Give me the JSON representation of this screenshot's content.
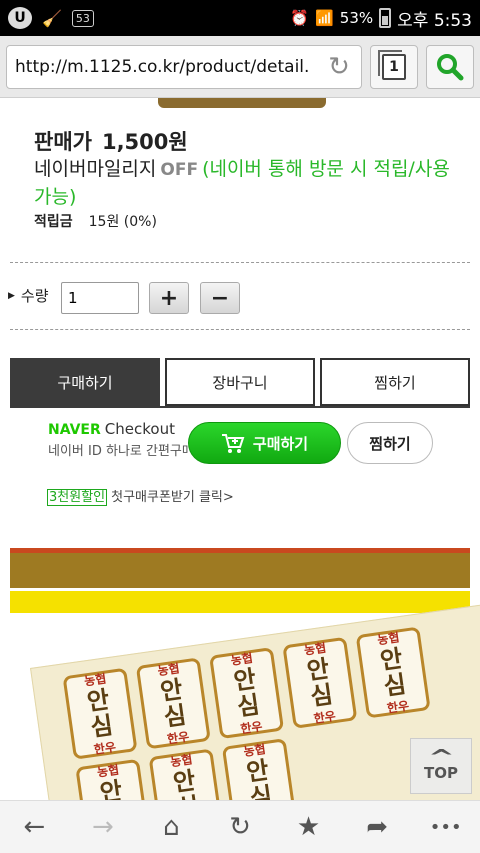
{
  "status_bar": {
    "badge": "53",
    "battery": "53%",
    "time": "오후 5:53"
  },
  "browser": {
    "url": "http://m.1125.co.kr/product/detail.",
    "tab_count": "1"
  },
  "product": {
    "price_label": "판매가",
    "price_value": "1,500원",
    "naver_mileage_label": "네이버마일리지",
    "naver_mileage_off": "OFF",
    "naver_mileage_note": "(네이버 통해 방문 시 적립/사용 가능)",
    "points_label": "적립금",
    "points_value": "15원 (0%)"
  },
  "quantity": {
    "label": "수량",
    "value": "1",
    "plus": "+",
    "minus": "−"
  },
  "actions": {
    "buy": "구매하기",
    "cart": "장바구니",
    "wish": "찜하기"
  },
  "naver_checkout": {
    "brand": "NAVER",
    "title": "Checkout",
    "subtitle": "네이버 ID 하나로 간편구매",
    "buy": "구매하기",
    "wish": "찜하기"
  },
  "coupon": {
    "tag": "3천원할인",
    "text": "첫구매쿠폰받기 클릭>"
  },
  "sticker": {
    "top": "농협",
    "main1": "안",
    "main2": "심",
    "sub": "한우"
  },
  "top_button": "TOP",
  "bottom_nav": {
    "back": "←",
    "forward": "→",
    "home": "⌂",
    "refresh": "↻",
    "bookmark": "★",
    "share": "➦",
    "more": "•••"
  },
  "colors": {
    "naver_green": "#1ec800",
    "action_dark": "#3b3b3b",
    "product_gold": "#9e7a22",
    "product_yellow": "#f5e100"
  }
}
